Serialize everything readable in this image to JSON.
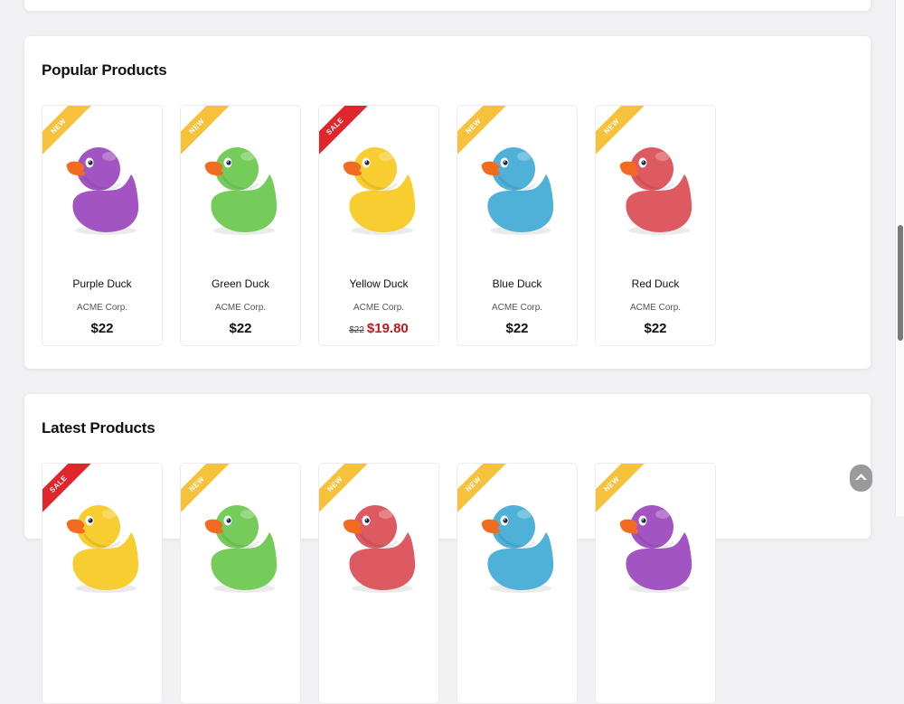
{
  "popular": {
    "title": "Popular Products",
    "products": [
      {
        "name": "Purple Duck",
        "manufacturer": "ACME Corp.",
        "price": "$22",
        "badge": "NEW",
        "color": "#a255c2"
      },
      {
        "name": "Green Duck",
        "manufacturer": "ACME Corp.",
        "price": "$22",
        "badge": "NEW",
        "color": "#76cc5b"
      },
      {
        "name": "Yellow Duck",
        "manufacturer": "ACME Corp.",
        "regular_price": "$22",
        "campaign_price": "$19.80",
        "badge": "SALE",
        "color": "#f8cd2f"
      },
      {
        "name": "Blue Duck",
        "manufacturer": "ACME Corp.",
        "price": "$22",
        "badge": "NEW",
        "color": "#4fb0d8"
      },
      {
        "name": "Red Duck",
        "manufacturer": "ACME Corp.",
        "price": "$22",
        "badge": "NEW",
        "color": "#dd5a61"
      }
    ]
  },
  "latest": {
    "title": "Latest Products",
    "products": [
      {
        "badge": "SALE",
        "color": "#f8cd2f"
      },
      {
        "badge": "NEW",
        "color": "#76cc5b"
      },
      {
        "badge": "NEW",
        "color": "#dd5a61"
      },
      {
        "badge": "NEW",
        "color": "#4fb0d8"
      },
      {
        "badge": "NEW",
        "color": "#a255c2"
      }
    ]
  },
  "icons": {
    "scroll_to_top": "chevron-up-icon"
  }
}
